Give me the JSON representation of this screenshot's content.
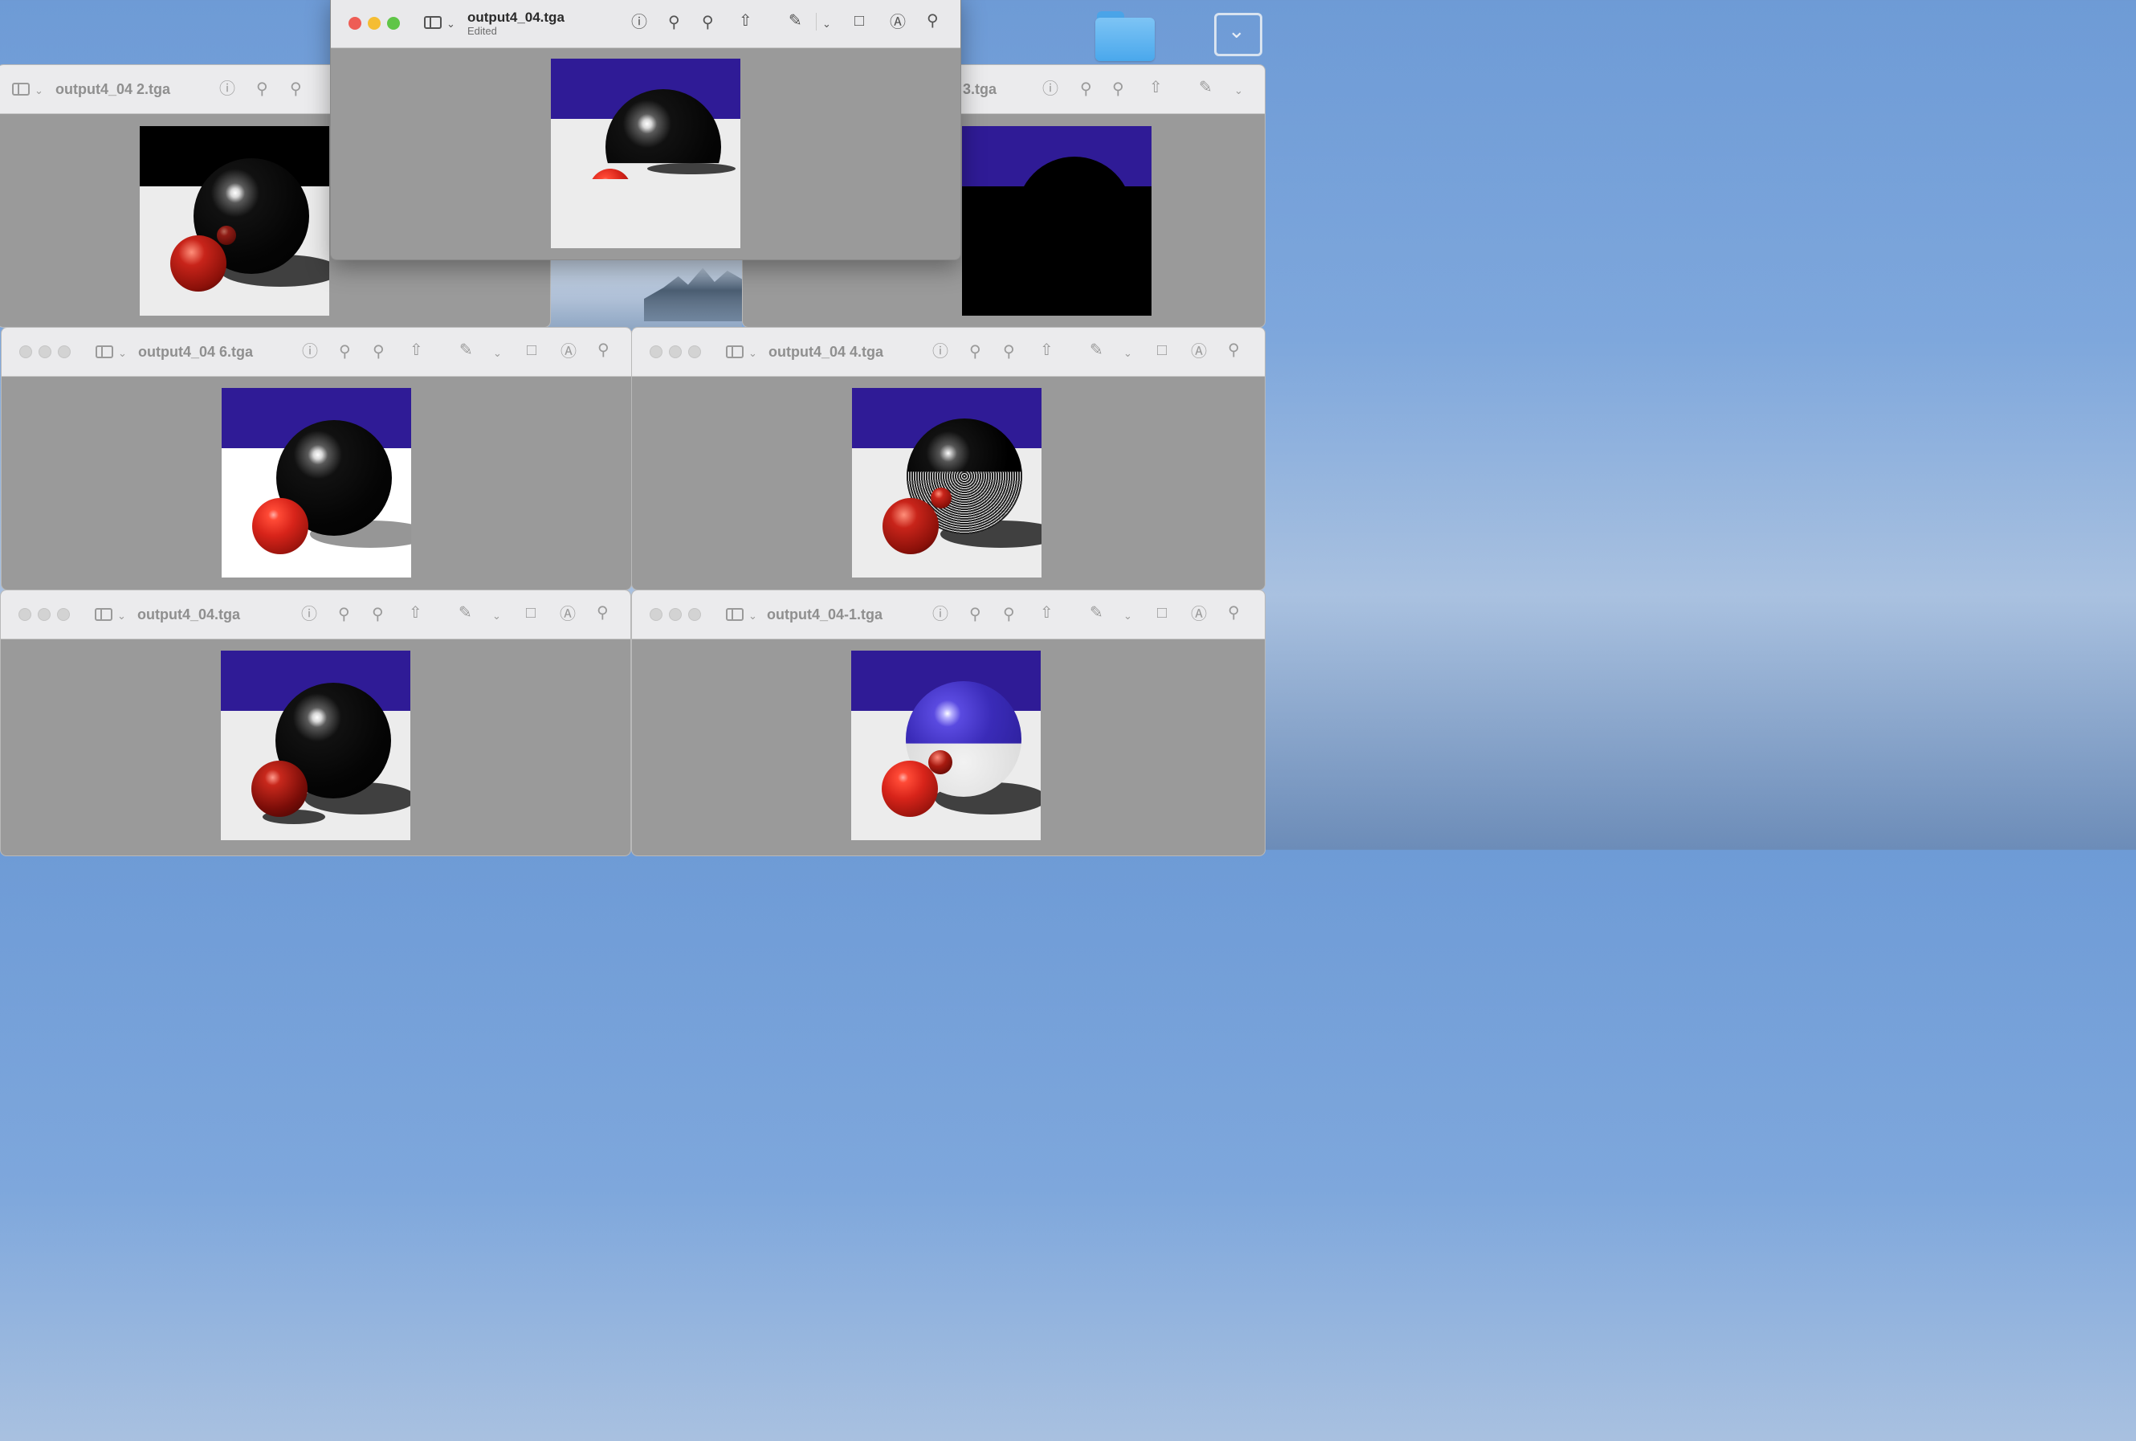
{
  "desktop": {
    "folder_icon": "folder-icon",
    "tray_icon": "chevron-down-icon"
  },
  "windows": {
    "front": {
      "title": "output4_04.tga",
      "subtitle": "Edited"
    },
    "top_left": {
      "title": "output4_04 2.tga"
    },
    "top_right": {
      "title": "3.tga"
    },
    "mid_left": {
      "title": "output4_04 6.tga"
    },
    "mid_right": {
      "title": "output4_04 4.tga"
    },
    "bottom_left": {
      "title": "output4_04.tga"
    },
    "bottom_right": {
      "title": "output4_04-1.tga"
    }
  },
  "toolbar_icons": [
    "sidebar-icon",
    "info-icon",
    "zoom-out-icon",
    "zoom-in-icon",
    "share-icon",
    "markup-pen-icon",
    "rotate-icon",
    "annotate-icon",
    "search-icon"
  ],
  "colors": {
    "sky_blue": "#2f1b96",
    "floor": "#ececec",
    "viewer_bg": "#9a9a9a",
    "close": "#ee5d55",
    "minimize": "#f5bd33",
    "zoom": "#5fc547"
  }
}
